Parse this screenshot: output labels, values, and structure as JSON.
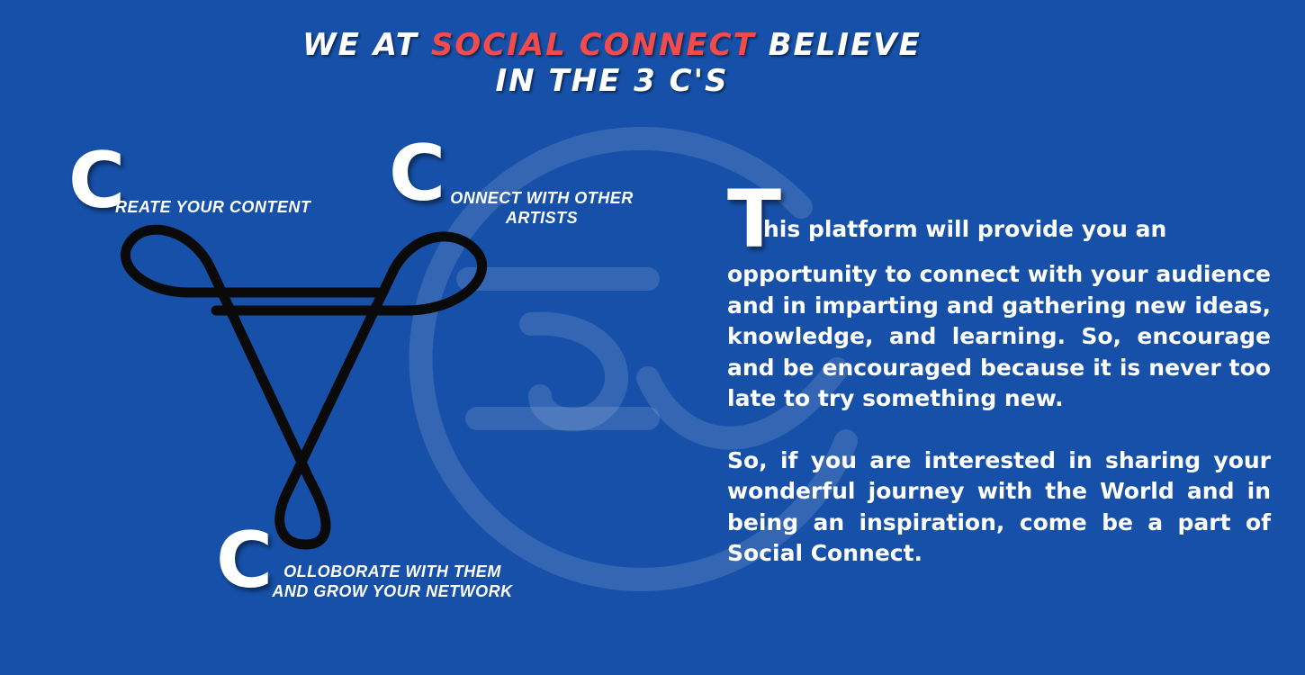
{
  "heading": {
    "line1_prefix": "WE AT ",
    "line1_brand": "SOCIAL CONNECT",
    "line1_suffix": " BELIEVE",
    "line2": "IN THE 3 C'S"
  },
  "c_items": [
    {
      "letter": "C",
      "label": "REATE YOUR CONTENT"
    },
    {
      "letter": "C",
      "label_line1": "ONNECT WITH OTHER",
      "label_line2": "ARTISTS"
    },
    {
      "letter": "C",
      "label_line1": "OLLOBORATE WITH THEM",
      "label_line2": "AND GROW YOUR NETWORK"
    }
  ],
  "body": {
    "dropcap": "T",
    "lead": "his platform will provide you  an",
    "paragraph1": "opportunity to connect with your audience and in imparting and gathering new ideas, knowledge, and learning. So, encourage and be encouraged because it is never too late to try something new.",
    "paragraph2": "So, if you are interested in sharing your wonderful journey with the World and in being an inspiration, come be a part of Social Connect."
  },
  "colors": {
    "background": "#1650a8",
    "brand_accent": "#f24b4b",
    "text": "#ffffff",
    "knot": "#0a0a0a"
  },
  "icons": {
    "knot": "triquetra-knot-icon",
    "watermark": "social-connect-logo-watermark"
  }
}
